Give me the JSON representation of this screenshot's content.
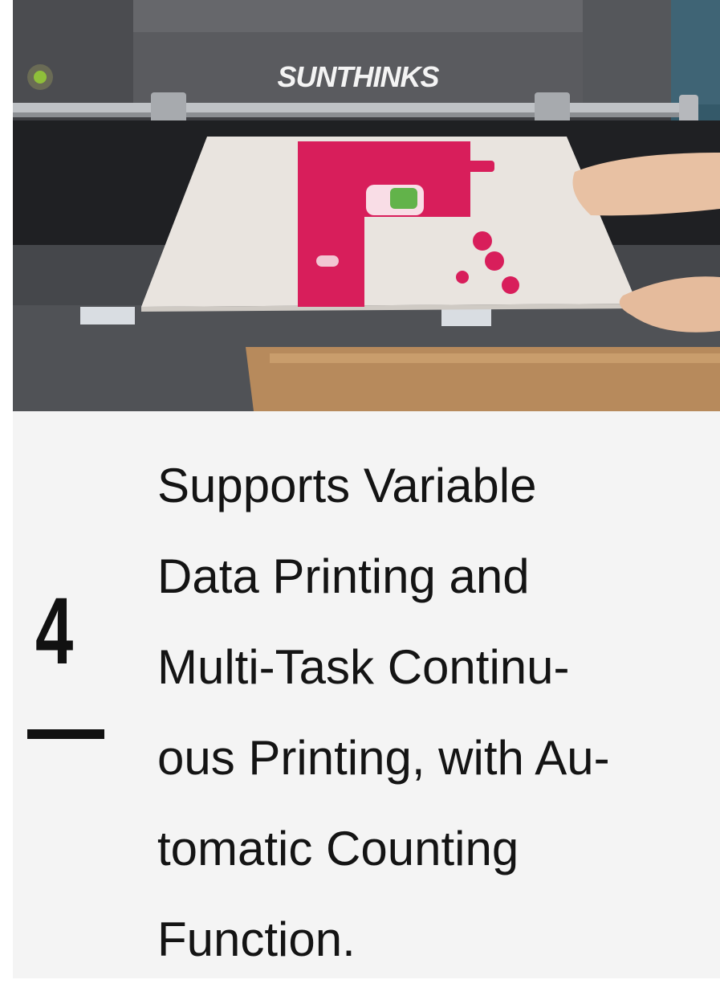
{
  "photo": {
    "brand_text": "SUNTHINKS"
  },
  "feature": {
    "number": "4",
    "lines": [
      "Supports Variable",
      "Data Printing and",
      "Multi-Task Continu-",
      "ous Printing, with Au-",
      "tomatic Counting",
      "Function."
    ]
  },
  "colors": {
    "panel_background": "#f4f4f4",
    "text": "#141414",
    "print_accent": "#d81e5b"
  }
}
